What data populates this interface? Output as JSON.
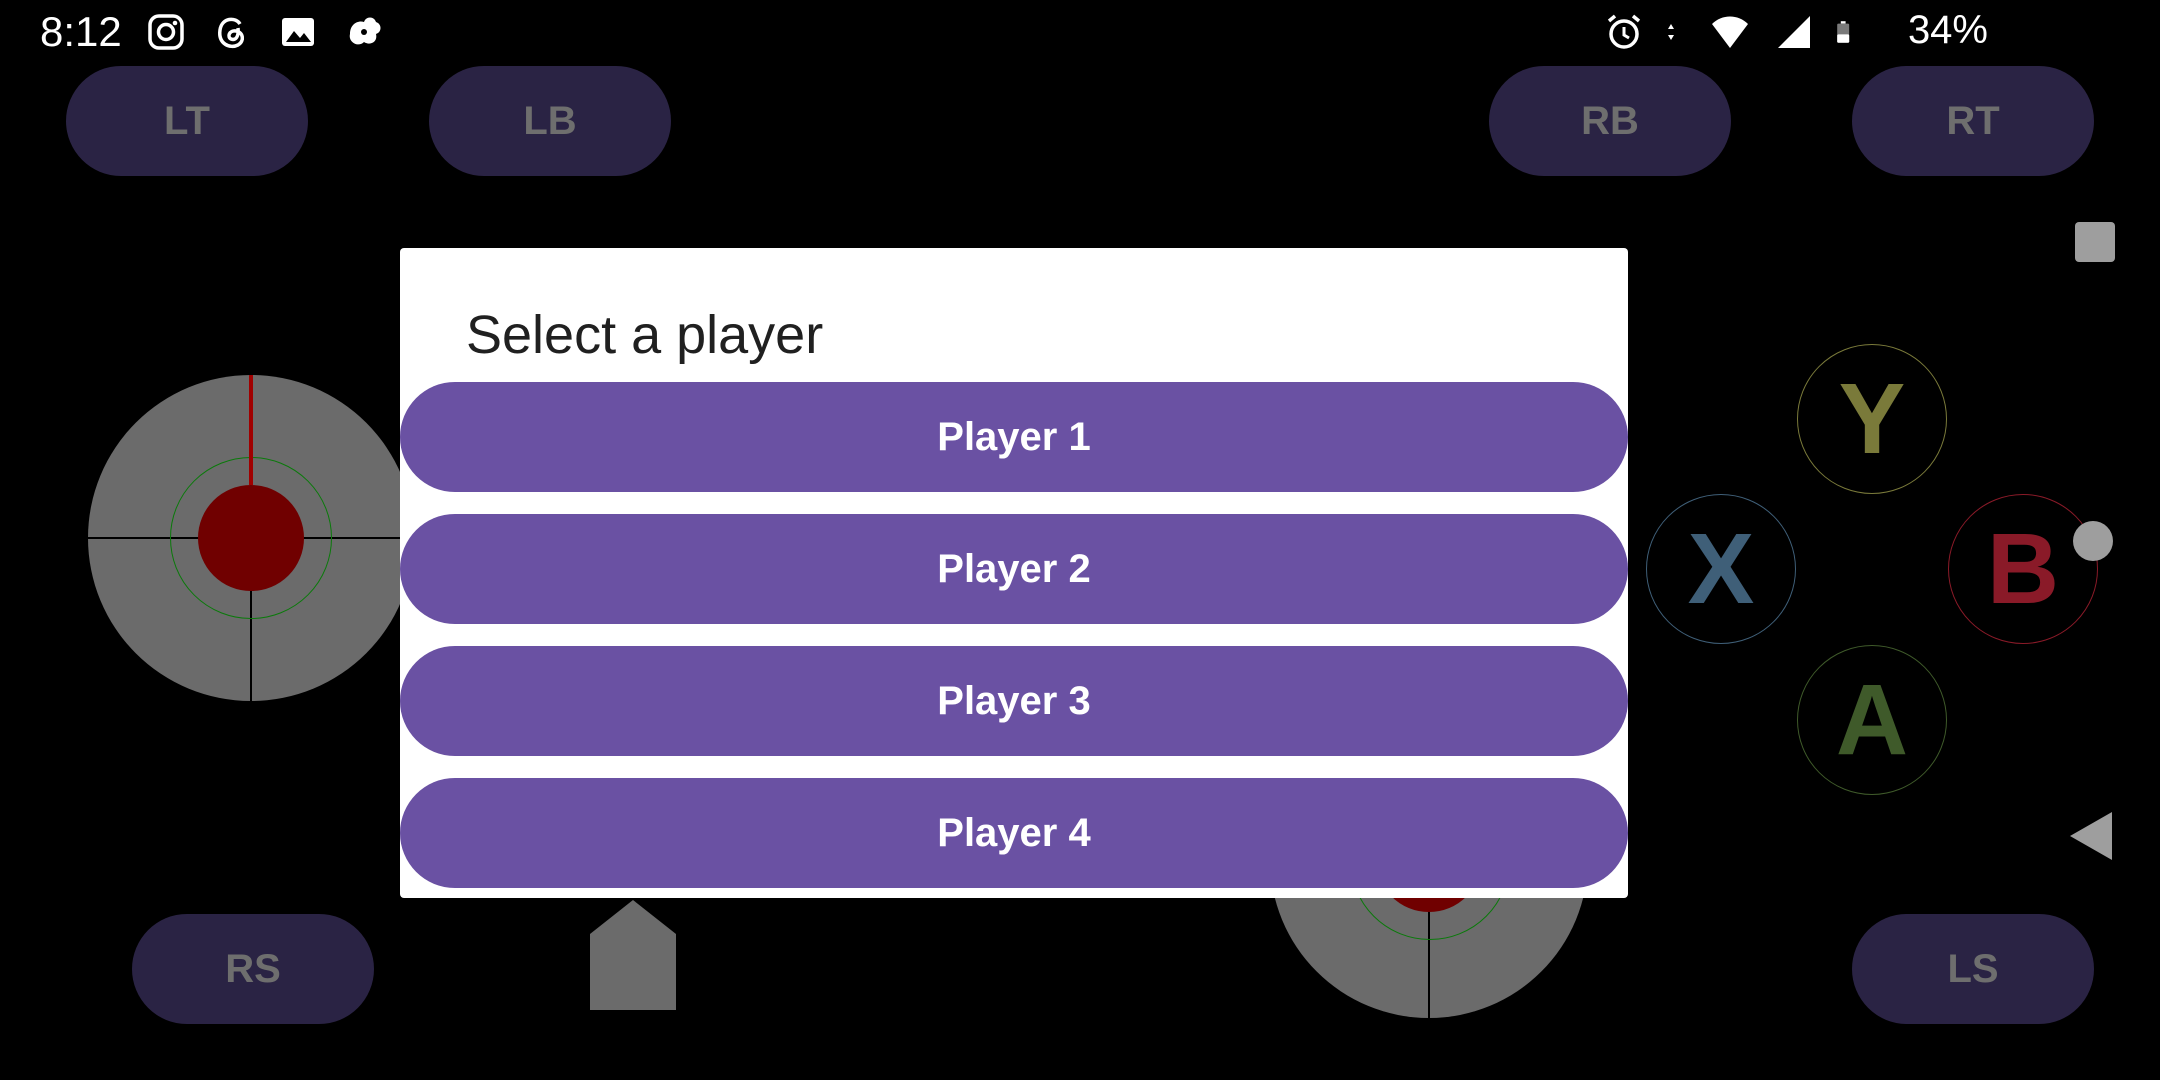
{
  "status_bar": {
    "time": "8:12",
    "notification_icons": [
      "instagram-icon",
      "threads-icon",
      "gallery-icon",
      "app-icon"
    ],
    "system_icons": [
      "alarm-icon",
      "data-arrows-icon",
      "wifi-icon",
      "signal-icon",
      "battery-icon"
    ],
    "battery_percent": "34%"
  },
  "controller": {
    "top_buttons": {
      "lt": "LT",
      "lb": "LB",
      "rb": "RB",
      "rt": "RT"
    },
    "bottom_buttons": {
      "rs": "RS",
      "ls": "LS"
    },
    "face_buttons": {
      "y": {
        "label": "Y",
        "color": "#7a7a3a"
      },
      "x": {
        "label": "X",
        "color": "#3f5f78"
      },
      "b": {
        "label": "B",
        "color": "#8a1a28"
      },
      "a": {
        "label": "A",
        "color": "#3f5a2a"
      }
    }
  },
  "dialog": {
    "title": "Select a player",
    "options": [
      "Player 1",
      "Player 2",
      "Player 3",
      "Player 4"
    ]
  },
  "colors": {
    "accent": "#6a51a3",
    "pill_bg": "#2a2344",
    "stick_bg": "#6b6b6b",
    "knob": "#700000"
  }
}
